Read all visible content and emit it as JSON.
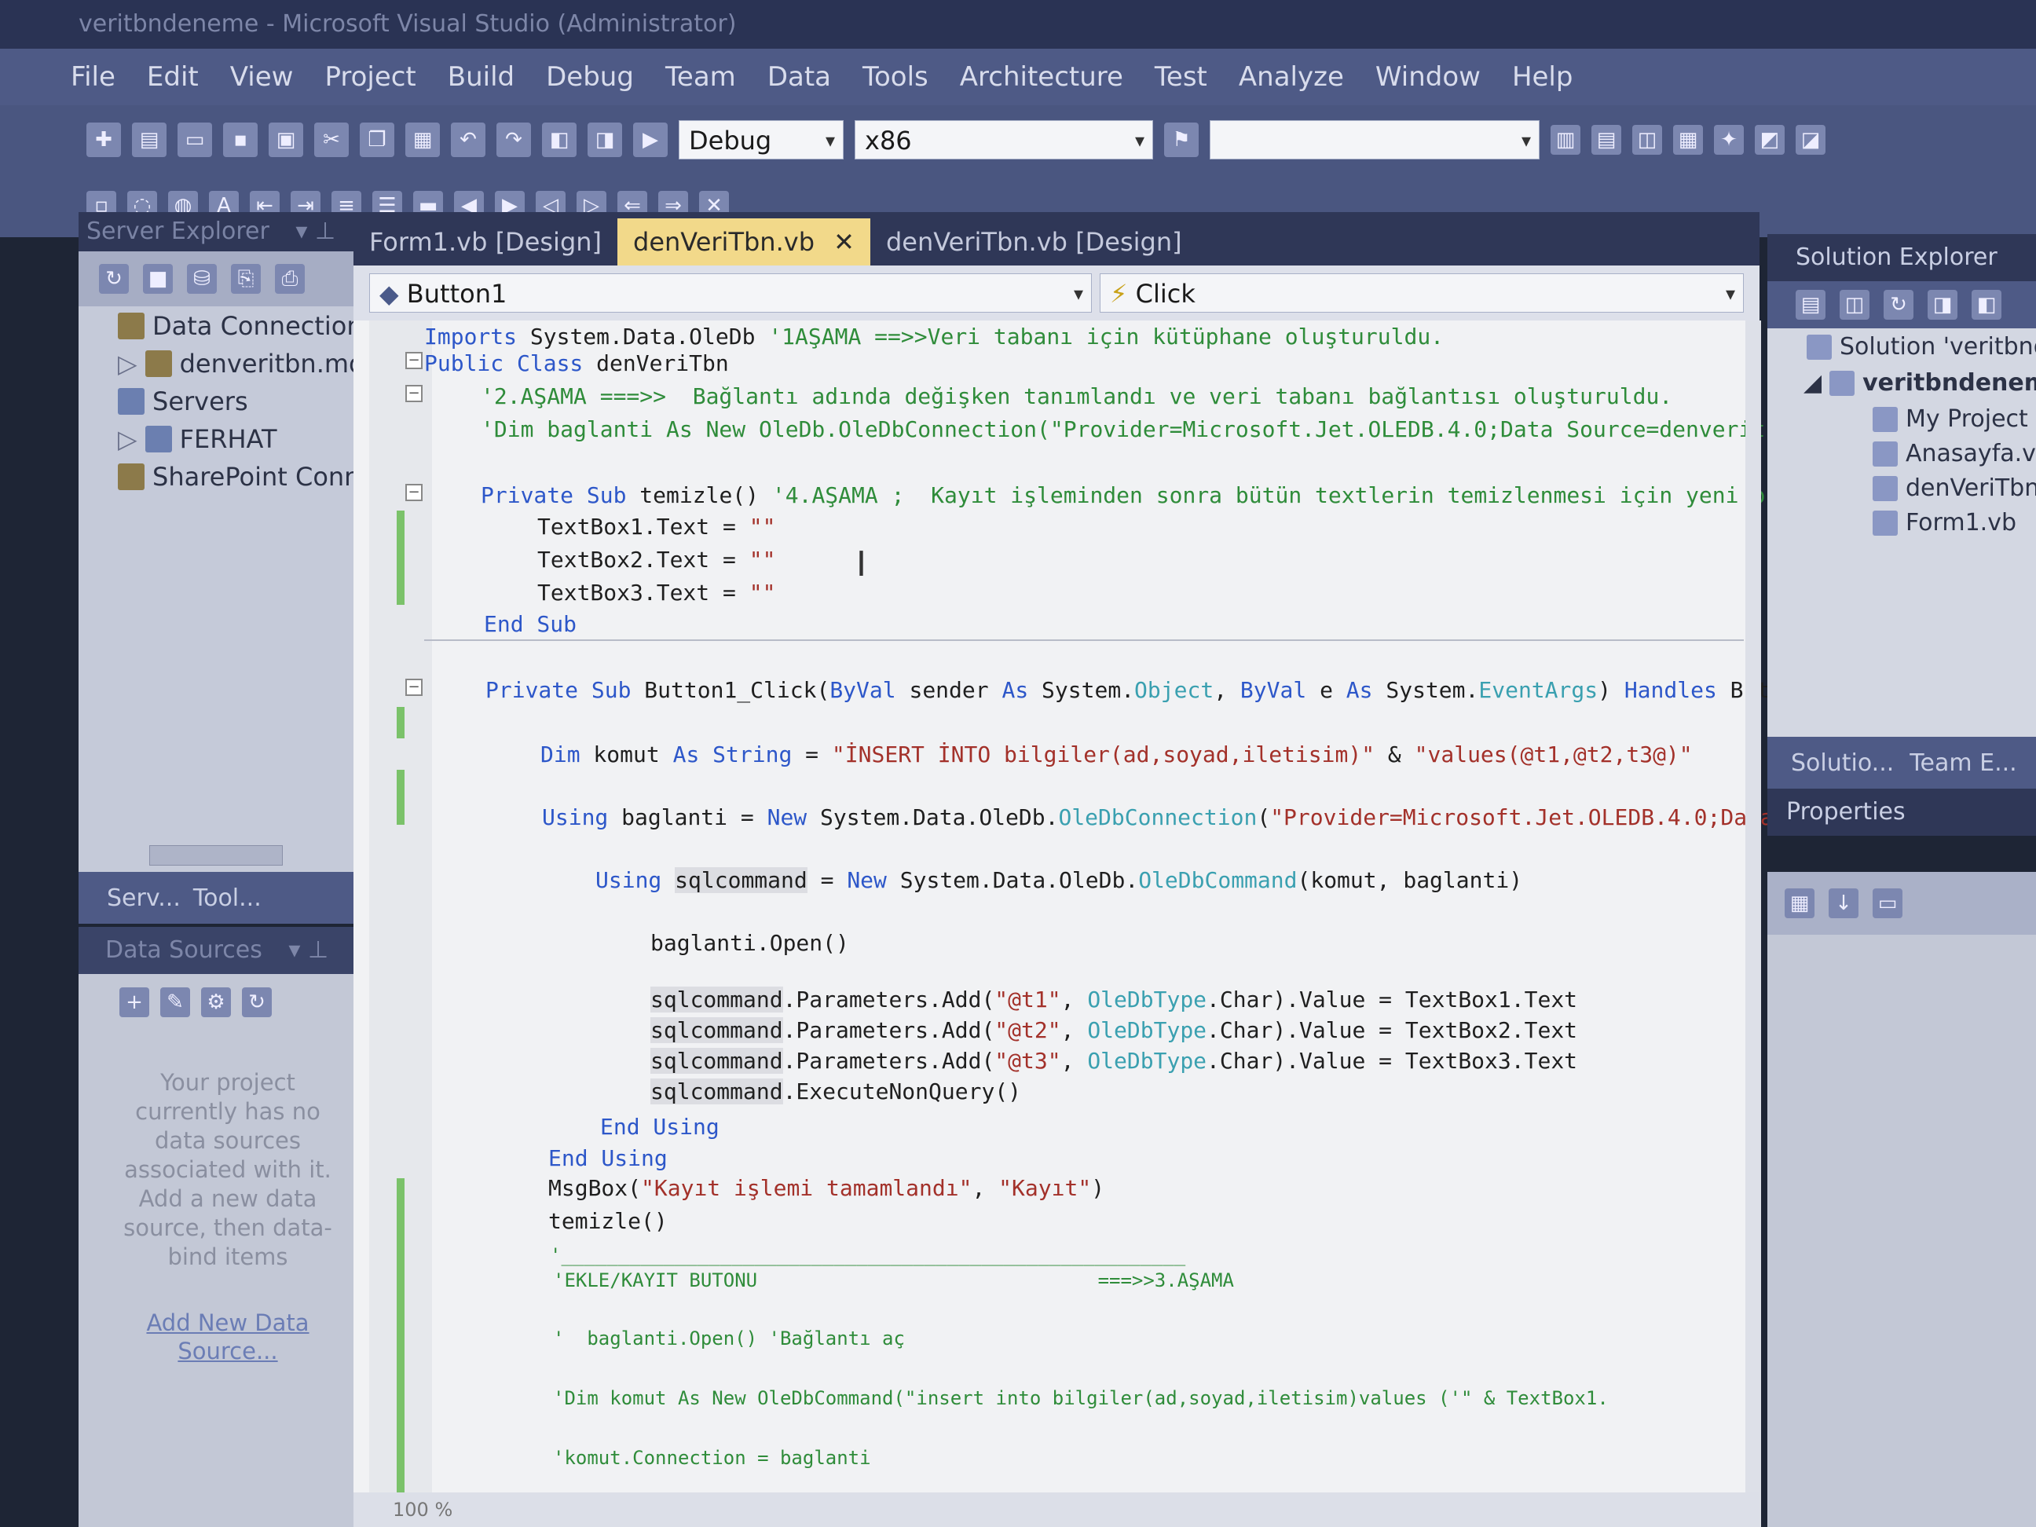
{
  "window": {
    "title": "veritbndeneme - Microsoft Visual Studio (Administrator)"
  },
  "menu": [
    "File",
    "Edit",
    "View",
    "Project",
    "Build",
    "Debug",
    "Team",
    "Data",
    "Tools",
    "Architecture",
    "Test",
    "Analyze",
    "Window",
    "Help"
  ],
  "toolbar": {
    "config": "Debug",
    "platform": "x86",
    "find_value": ""
  },
  "server_explorer": {
    "title": "Server Explorer",
    "items": [
      "Data Connections",
      "denveritbn.md",
      "Servers",
      "FERHAT",
      "SharePoint Conne"
    ],
    "tabs": [
      "Serv...",
      "Tool..."
    ]
  },
  "data_sources": {
    "title": "Data Sources",
    "message": "Your project currently has no data sources associated with it. Add a new data source, then data-bind items",
    "link": "Add New Data Source..."
  },
  "editor": {
    "tabs": [
      "Form1.vb [Design]",
      "denVeriTbn.vb",
      "denVeriTbn.vb [Design]"
    ],
    "object_combo": "Button1",
    "event_combo": "Click",
    "zoom": "100 %"
  },
  "solution_explorer": {
    "title": "Solution Explorer",
    "solution": "Solution 'veritbnden",
    "project": "veritbndeneme",
    "files": [
      "My Project",
      "Anasayfa.vb",
      "denVeriTbn.vb",
      "Form1.vb"
    ],
    "tabs": [
      "Solutio...",
      "Team E..."
    ]
  },
  "properties": {
    "title": "Properties"
  },
  "colors": {
    "keyword": "#2d57c9",
    "type": "#3aa0b0",
    "string": "#a3312a",
    "comment": "#2f8c3a",
    "active_tab": "#f2d98a"
  }
}
